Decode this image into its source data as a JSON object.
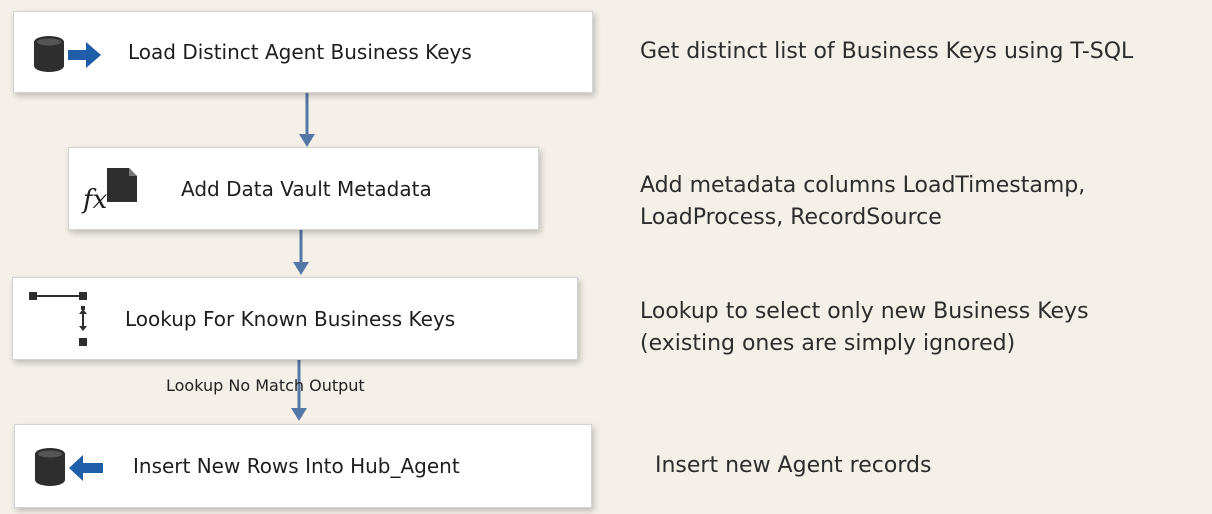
{
  "nodes": [
    {
      "label": "Load Distinct Agent Business Keys",
      "icon": "ole-db-source-icon"
    },
    {
      "label": "Add Data Vault Metadata",
      "icon": "derived-column-icon"
    },
    {
      "label": "Lookup For Known Business Keys",
      "icon": "lookup-icon"
    },
    {
      "label": "Insert New Rows Into Hub_Agent",
      "icon": "ole-db-destination-icon"
    }
  ],
  "descriptions": [
    {
      "lines": [
        "Get distinct list of Business Keys using T-SQL"
      ]
    },
    {
      "lines": [
        "Add metadata columns LoadTimestamp,",
        "LoadProcess, RecordSource"
      ]
    },
    {
      "lines": [
        "Lookup to select only new Business Keys",
        "(existing ones are simply ignored)"
      ]
    },
    {
      "lines": [
        "Insert new Agent records"
      ]
    }
  ],
  "path_label": "Lookup No Match Output",
  "colors": {
    "arrow": "#5577a7",
    "icon_blue": "#1f5ea8",
    "db_dark": "#2e2e2e"
  }
}
